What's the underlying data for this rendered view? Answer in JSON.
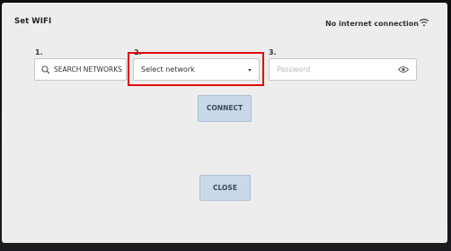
{
  "dialog": {
    "title": "Set WIFI",
    "status": "No internet connection"
  },
  "steps": {
    "one": "1.",
    "two": "2.",
    "three": "3."
  },
  "search_button": {
    "label": "SEARCH NETWORKS",
    "icon": "search-icon"
  },
  "network_select": {
    "selected": "Select network",
    "icon": "chevron-down-icon"
  },
  "password": {
    "placeholder": "Password",
    "value": "",
    "icon": "eye-icon"
  },
  "actions": {
    "connect": "CONNECT",
    "close": "CLOSE"
  },
  "colors": {
    "highlight": "#e10b0b",
    "button": "#c9d9ea",
    "screen_bg": "#ededed"
  }
}
